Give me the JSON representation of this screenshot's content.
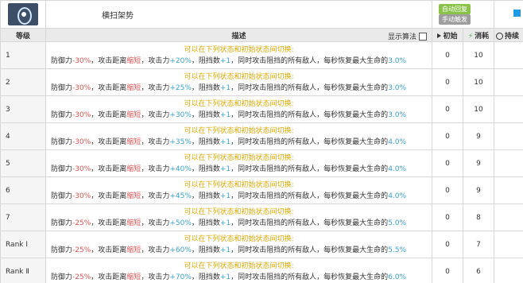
{
  "skill": {
    "name": "横扫架势",
    "tag_auto": "自动回复",
    "tag_manual": "手动触发",
    "square_color": "#1e9be6"
  },
  "columns": {
    "level": "等级",
    "desc": "描述",
    "toggle": "显示算法",
    "init": "初始",
    "cost": "消耗",
    "duration": "持续"
  },
  "rows": [
    {
      "level": "1",
      "line1": "可以在下列状态和初始状态间切换:",
      "def": "-30%",
      "atk": "+20%",
      "block": "+1",
      "hp": "3.0%",
      "init": "0",
      "cost": "10"
    },
    {
      "level": "2",
      "line1": "可以在下列状态和初始状态间切换:",
      "def": "-30%",
      "atk": "+25%",
      "block": "+1",
      "hp": "3.0%",
      "init": "0",
      "cost": "10"
    },
    {
      "level": "3",
      "line1": "可以在下列状态和初始状态间切换:",
      "def": "-30%",
      "atk": "+30%",
      "block": "+1",
      "hp": "3.0%",
      "init": "0",
      "cost": "10"
    },
    {
      "level": "4",
      "line1": "可以在下列状态和初始状态间切换:",
      "def": "-30%",
      "atk": "+35%",
      "block": "+1",
      "hp": "4.0%",
      "init": "0",
      "cost": "9"
    },
    {
      "level": "5",
      "line1": "可以在下列状态和初始状态间切换:",
      "def": "-30%",
      "atk": "+40%",
      "block": "+1",
      "hp": "4.0%",
      "init": "0",
      "cost": "9"
    },
    {
      "level": "6",
      "line1": "可以在下列状态和初始状态间切换:",
      "def": "-30%",
      "atk": "+45%",
      "block": "+1",
      "hp": "4.0%",
      "init": "0",
      "cost": "9"
    },
    {
      "level": "7",
      "line1": "可以在下列状态和初始状态间切换:",
      "def": "-25%",
      "atk": "+50%",
      "block": "+1",
      "hp": "5.0%",
      "init": "0",
      "cost": "8"
    },
    {
      "level": "Rank Ⅰ",
      "line1": "可以在下列状态和初始状态间切换:",
      "def": "-25%",
      "atk": "+60%",
      "block": "+1",
      "hp": "5.5%",
      "init": "0",
      "cost": "7"
    },
    {
      "level": "Rank Ⅱ",
      "line1": "可以在下列状态和初始状态间切换:",
      "def": "-25%",
      "atk": "+70%",
      "block": "+1",
      "hp": "6.0%",
      "init": "0",
      "cost": "6"
    }
  ],
  "text": {
    "def_label": "防御力",
    "range_label": "，攻击距离",
    "range_value": "缩短",
    "atk_label": "，攻击力",
    "block_label": "，阻挡数",
    "mid": "，同时攻击阻挡的所有敌人，每秒恢复最大生命的"
  }
}
